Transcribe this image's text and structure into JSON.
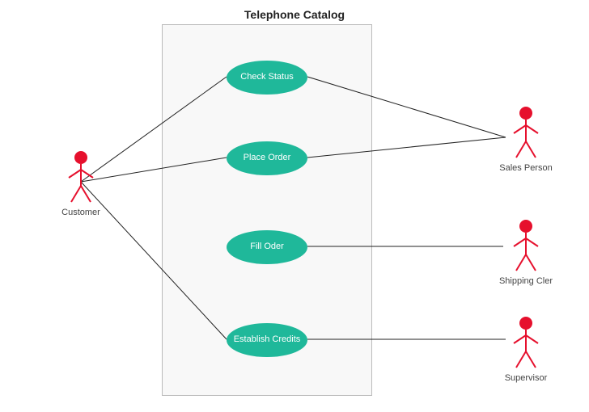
{
  "title": "Telephone Catalog",
  "usecases": {
    "check_status": "Check Status",
    "place_order": "Place Order",
    "fill_order": "Fill Oder",
    "establish_credits": "Establish Credits"
  },
  "actors": {
    "customer": "Customer",
    "sales_person": "Sales Person",
    "shipping_clerk": "Shipping Cler",
    "supervisor": "Supervisor"
  },
  "diagram_type": "UML Use Case Diagram",
  "associations": [
    [
      "customer",
      "check_status"
    ],
    [
      "customer",
      "place_order"
    ],
    [
      "customer",
      "establish_credits"
    ],
    [
      "sales_person",
      "check_status"
    ],
    [
      "sales_person",
      "place_order"
    ],
    [
      "shipping_clerk",
      "fill_order"
    ],
    [
      "supervisor",
      "establish_credits"
    ]
  ],
  "colors": {
    "actor_stroke": "#e6102d",
    "usecase_fill": "#1fb89a",
    "box_border": "#bbbbbb",
    "box_fill": "#f8f8f8"
  }
}
